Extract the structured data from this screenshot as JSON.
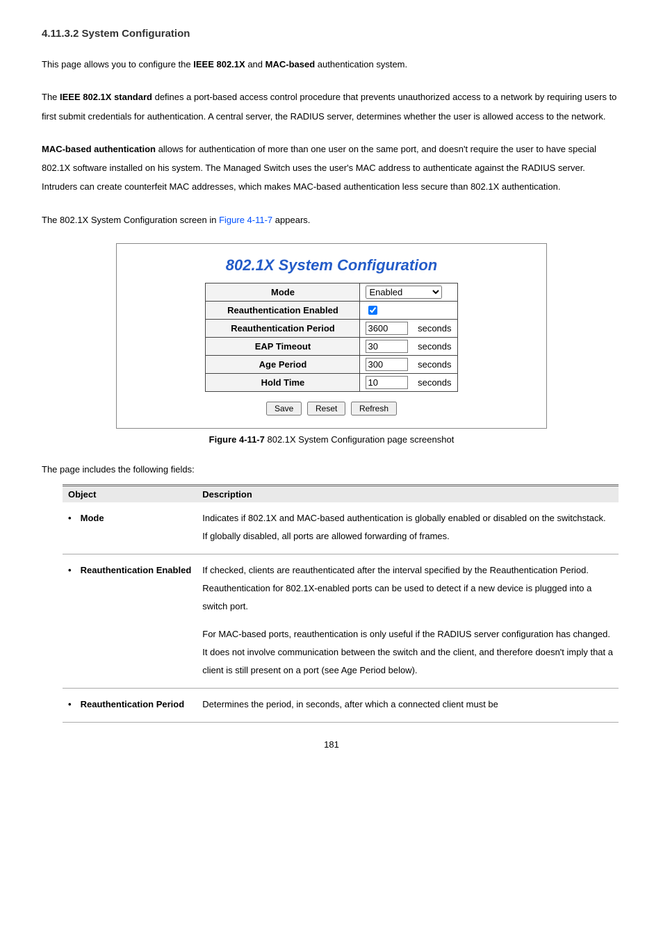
{
  "section_title": "4.11.3.2 System Configuration",
  "p1": {
    "a": "This page allows you to configure the ",
    "b_bold": "IEEE 802.1X",
    "c": " and ",
    "d_bold": "MAC-based",
    "e": " authentication system."
  },
  "p2": {
    "a": "The ",
    "b_bold": "IEEE 802.1X standard",
    "c": " defines a port-based access control procedure that prevents unauthorized access to a network by requiring users to first submit credentials for authentication. A central server, the RADIUS server, determines whether the user is allowed access to the network."
  },
  "p3": {
    "a_bold": "MAC-based authentication",
    "b": " allows for authentication of more than one user on the same port, and doesn't require the user to have special 802.1X software installed on his system. The Managed Switch uses the user's MAC address to authenticate against the RADIUS server. Intruders can create counterfeit MAC addresses, which makes MAC-based authentication less secure than 802.1X authentication."
  },
  "p4": {
    "a": "The 802.1X System Configuration screen in ",
    "link": "Figure 4-11-7",
    "b": " appears."
  },
  "figure": {
    "title": "802.1X System Configuration",
    "rows": {
      "mode": {
        "label": "Mode",
        "value": "Enabled"
      },
      "reauth_en": {
        "label": "Reauthentication Enabled"
      },
      "reauth_per": {
        "label": "Reauthentication Period",
        "value": "3600",
        "unit": "seconds"
      },
      "eap_to": {
        "label": "EAP Timeout",
        "value": "30",
        "unit": "seconds"
      },
      "age": {
        "label": "Age Period",
        "value": "300",
        "unit": "seconds"
      },
      "hold": {
        "label": "Hold Time",
        "value": "10",
        "unit": "seconds"
      }
    },
    "buttons": {
      "save": "Save",
      "reset": "Reset",
      "refresh": "Refresh"
    },
    "caption_prefix": "Figure 4-11-7",
    "caption_rest": " 802.1X System Configuration page screenshot"
  },
  "fields_intro": "The page includes the following fields:",
  "table_head": {
    "object": "Object",
    "description": "Description"
  },
  "fields": {
    "mode": {
      "name": "Mode",
      "desc1": "Indicates if 802.1X and MAC-based authentication is globally enabled or disabled on the switchstack. If globally disabled, all ports are allowed forwarding of frames."
    },
    "reauth_en": {
      "name": "Reauthentication Enabled",
      "desc1": "If checked, clients are reauthenticated after the interval specified by the Reauthentication Period. Reauthentication for 802.1X-enabled ports can be used to detect if a new device is plugged into a switch port.",
      "desc2": "For MAC-based ports, reauthentication is only useful if the RADIUS server configuration has changed. It does not involve communication between the switch and the client, and therefore doesn't imply that a client is still present on a port (see Age Period below)."
    },
    "reauth_per": {
      "name": "Reauthentication Period",
      "desc1": "Determines the period, in seconds, after which a connected client must be"
    }
  },
  "page_number": "181"
}
